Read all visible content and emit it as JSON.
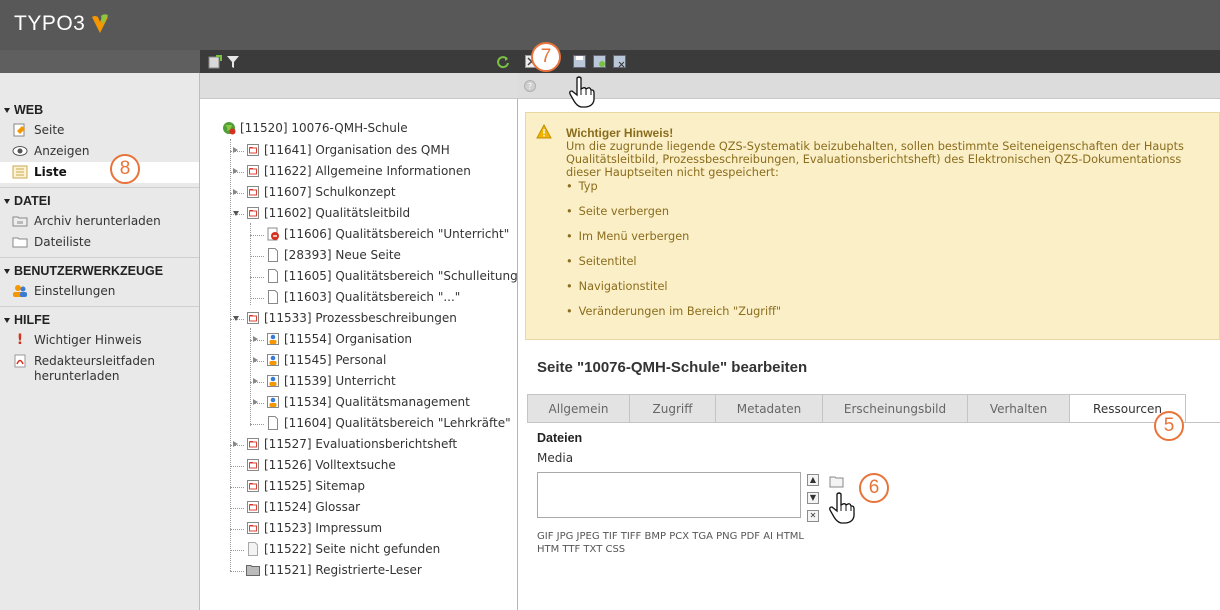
{
  "app": {
    "name": "TYPO3"
  },
  "colors": {
    "accent": "#e8743b",
    "topbar": "#585858",
    "warn_bg": "#fbefc8",
    "warn_text": "#8a6d1c"
  },
  "module_menu": [
    {
      "title": "WEB",
      "items": [
        {
          "label": "Seite",
          "icon": "page-module-icon"
        },
        {
          "label": "Anzeigen",
          "icon": "eye-icon"
        },
        {
          "label": "Liste",
          "icon": "list-icon",
          "active": true
        }
      ]
    },
    {
      "title": "DATEI",
      "items": [
        {
          "label": "Archiv herunterladen",
          "icon": "archive-icon"
        },
        {
          "label": "Dateiliste",
          "icon": "folder-icon"
        }
      ]
    },
    {
      "title": "BENUTZERWERKZEUGE",
      "items": [
        {
          "label": "Einstellungen",
          "icon": "users-icon"
        }
      ]
    },
    {
      "title": "HILFE",
      "items": [
        {
          "label": "Wichtiger Hinweis",
          "icon": "exclamation-icon"
        },
        {
          "label": "Redakteursleitfaden herunterladen",
          "icon": "pdf-icon"
        }
      ]
    }
  ],
  "tree": {
    "root": "[11520] 10076-QMH-Schule",
    "nodes": [
      {
        "label": "[11641] Organisation des QMH",
        "icon": "folder-page"
      },
      {
        "label": "[11622] Allgemeine Informationen",
        "icon": "folder-page"
      },
      {
        "label": "[11607] Schulkonzept",
        "icon": "folder-page"
      },
      {
        "label": "[11602] Qualitätsleitbild",
        "icon": "folder-page"
      },
      {
        "label": "[11606] Qualitätsbereich \"Unterricht\"",
        "icon": "restricted-page"
      },
      {
        "label": "[28393] Neue Seite",
        "icon": "page"
      },
      {
        "label": "[11605] Qualitätsbereich \"Schulleitung..",
        "icon": "page"
      },
      {
        "label": "[11603] Qualitätsbereich \"...\"",
        "icon": "page"
      },
      {
        "label": "[11533] Prozessbeschreibungen",
        "icon": "folder-page"
      },
      {
        "label": "[11554] Organisation",
        "icon": "user-page"
      },
      {
        "label": "[11545] Personal",
        "icon": "user-page"
      },
      {
        "label": "[11539] Unterricht",
        "icon": "user-page"
      },
      {
        "label": "[11534] Qualitätsmanagement",
        "icon": "user-page"
      },
      {
        "label": "[11604] Qualitätsbereich \"Lehrkräfte\"",
        "icon": "page"
      },
      {
        "label": "[11527] Evaluationsberichtsheft",
        "icon": "folder-page"
      },
      {
        "label": "[11526] Volltextsuche",
        "icon": "folder-page"
      },
      {
        "label": "[11525] Sitemap",
        "icon": "folder-page"
      },
      {
        "label": "[11524] Glossar",
        "icon": "folder-page"
      },
      {
        "label": "[11523] Impressum",
        "icon": "folder-page"
      },
      {
        "label": "[11522] Seite nicht gefunden",
        "icon": "page-grey"
      },
      {
        "label": "[11521] Registrierte-Leser",
        "icon": "sysfolder"
      }
    ]
  },
  "warning": {
    "title": "Wichtiger Hinweis!",
    "lines": [
      "Um die zugrunde liegende QZS-Systematik beizubehalten, sollen bestimmte Seiteneigenschaften der Haupts",
      "Qualitätsleitbild, Prozessbeschreibungen, Evaluationsberichtsheft) des Elektronischen QZS-Dokumentationss",
      "dieser Hauptseiten nicht gespeichert:"
    ],
    "items": [
      "Typ",
      "Seite verbergen",
      "Im Menü verbergen",
      "Seitentitel",
      "Navigationstitel",
      "Veränderungen im Bereich \"Zugriff\""
    ]
  },
  "editor": {
    "heading": "Seite \"10076-QMH-Schule\" bearbeiten",
    "tabs": [
      "Allgemein",
      "Zugriff",
      "Metadaten",
      "Erscheinungsbild",
      "Verhalten",
      "Ressourcen"
    ],
    "active_tab": "Ressourcen",
    "section_title": "Dateien",
    "field_label": "Media",
    "allowed_types": "GIF JPG JPEG TIF TIFF BMP PCX TGA PNG PDF AI HTML HTM TTF TXT CSS"
  },
  "callouts": {
    "c5": "5",
    "c6": "6",
    "c7": "7",
    "c8": "8"
  }
}
